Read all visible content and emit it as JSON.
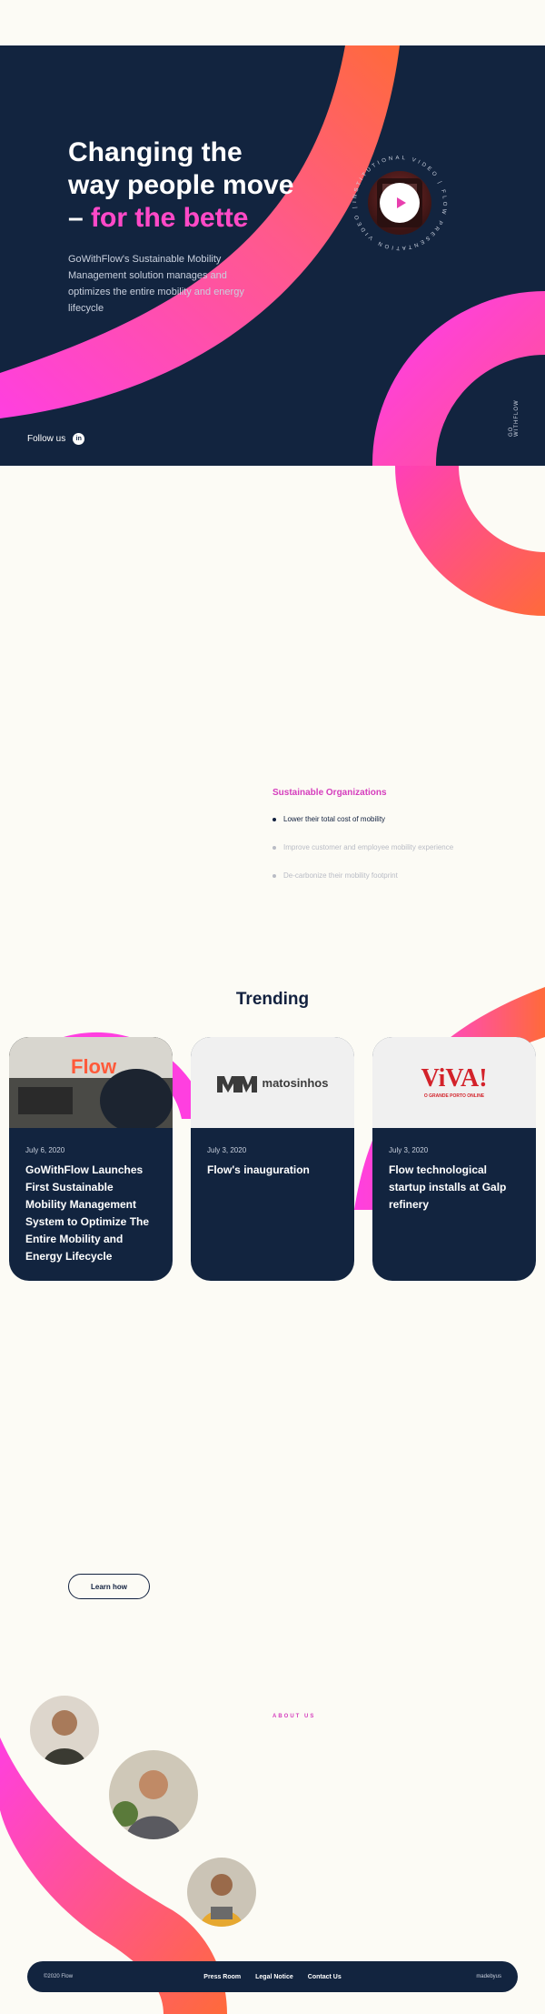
{
  "colors": {
    "navy": "#12243f",
    "pink": "#ff3fe0",
    "orange": "#ff6a3a",
    "accent_text": "#d53dbd",
    "cream": "#fcfbf5"
  },
  "hero": {
    "title_line1": "Changing the",
    "title_line2": "way people move",
    "title_line3_dash": "–",
    "title_line3_accent": "for the bette",
    "subtitle": "GoWithFlow's Sustainable Mobility Management solution manages and optimizes the entire mobility and energy lifecycle",
    "follow_label": "Follow us",
    "linkedin_icon": "linkedin-icon",
    "video_ring_text": "INSTITUTIONAL VIDEO | FLOW PRESENTATION VIDEO |",
    "scroll_label": "GO WITHFLOW",
    "slides": 2,
    "active_slide": 1
  },
  "organizations": {
    "label": "Sustainable Organizations",
    "items": [
      {
        "text": "Lower their total cost of mobility",
        "active": true
      },
      {
        "text": "Improve customer and employee mobility experience",
        "active": false
      },
      {
        "text": "De-carbonize their mobility footprint",
        "active": false
      }
    ]
  },
  "trending": {
    "title": "Trending",
    "cards": [
      {
        "date": "July 6, 2020",
        "title": "GoWithFlow Launches First Sustainable Mobility Management System to Optimize The Entire Mobility and Energy Lifecycle",
        "logo": "Flow"
      },
      {
        "date": "July 3, 2020",
        "title": "Flow's inauguration",
        "logo": "matosinhos"
      },
      {
        "date": "July 3, 2020",
        "title": "Flow technological startup installs at Galp refinery",
        "logo": "ViVA!",
        "logo_sub": "O GRANDE PORTO ONLINE"
      }
    ]
  },
  "learn_button": "Learn how",
  "about": {
    "label": "ABOUT US"
  },
  "footer": {
    "copyright": "©2020 Flow",
    "links": [
      "Press Room",
      "Legal Notice",
      "Contact Us"
    ],
    "made_by": "madebyus"
  }
}
